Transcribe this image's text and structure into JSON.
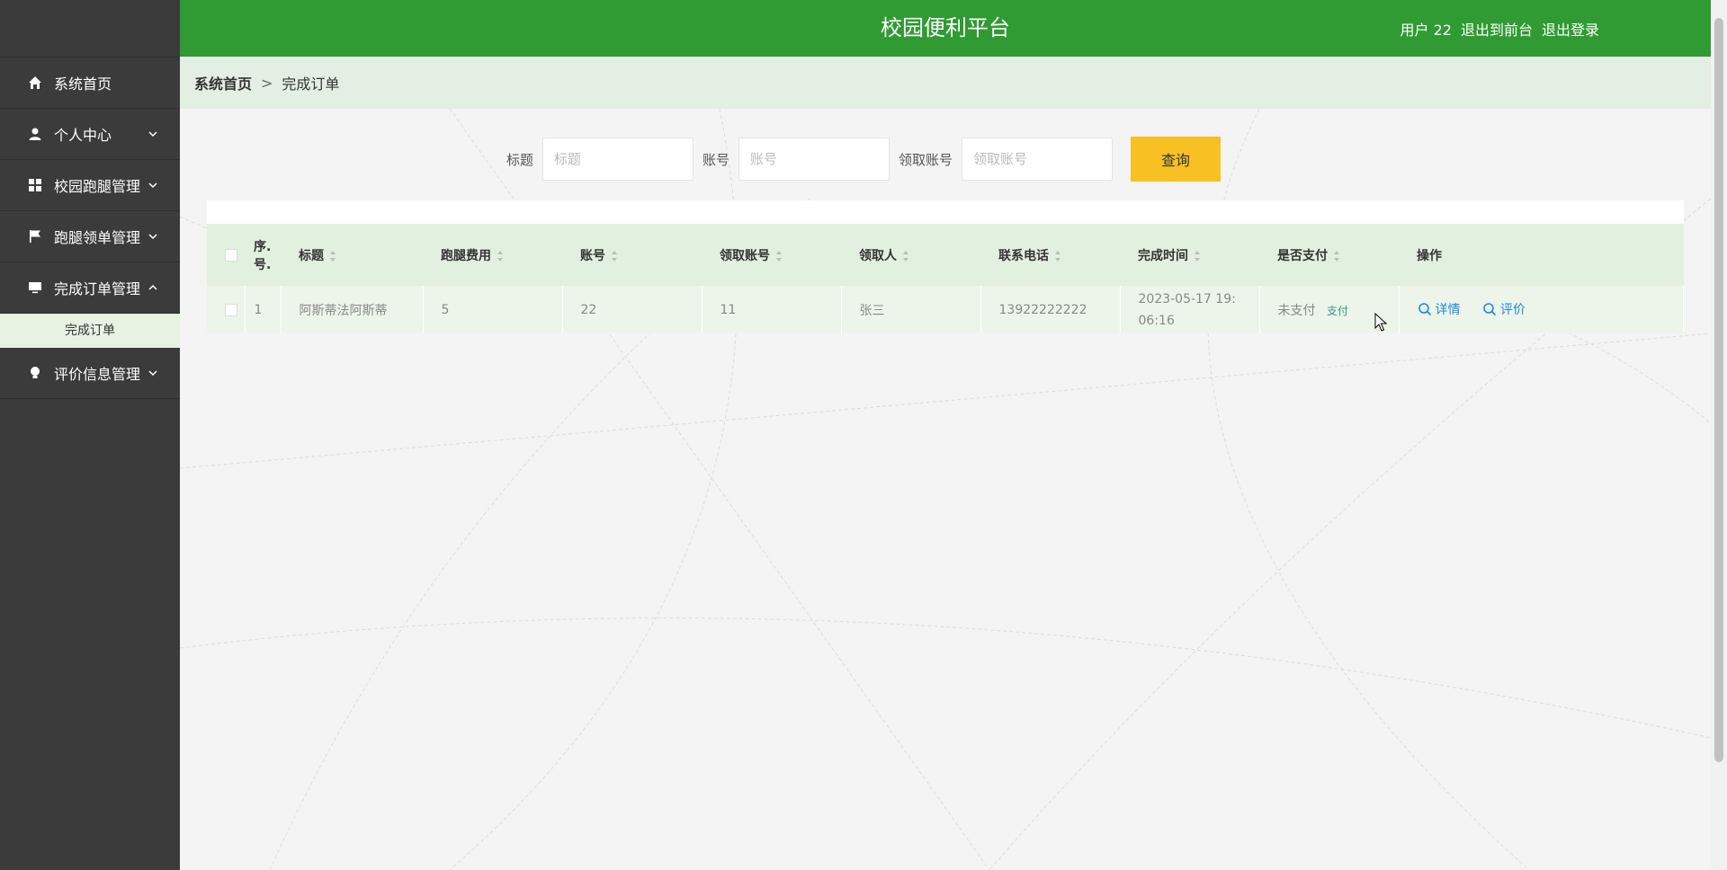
{
  "header": {
    "title": "校园便利平台",
    "user": "用户 22",
    "to_front": "退出到前台",
    "logout": "退出登录"
  },
  "sidebar": {
    "items": [
      {
        "label": "系统首页",
        "icon": "home-icon"
      },
      {
        "label": "个人中心",
        "icon": "user-icon"
      },
      {
        "label": "校园跑腿管理",
        "icon": "grid-icon"
      },
      {
        "label": "跑腿领单管理",
        "icon": "flag-icon"
      },
      {
        "label": "完成订单管理",
        "icon": "monitor-icon"
      },
      {
        "label": "评价信息管理",
        "icon": "bulb-icon"
      }
    ],
    "submenu": {
      "label": "完成订单"
    }
  },
  "breadcrumb": {
    "home": "系统首页",
    "sep": ">",
    "current": "完成订单"
  },
  "search": {
    "title_label": "标题",
    "title_placeholder": "标题",
    "account_label": "账号",
    "account_placeholder": "账号",
    "receiver_label": "领取账号",
    "receiver_placeholder": "领取账号",
    "button": "查询"
  },
  "table": {
    "headers": {
      "index": "序.号.",
      "title": "标题",
      "fee": "跑腿费用",
      "account": "账号",
      "receiver_account": "领取账号",
      "receiver": "领取人",
      "phone": "联系电话",
      "finish_time": "完成时间",
      "paid": "是否支付",
      "ops": "操作"
    },
    "rows": [
      {
        "index": "1",
        "title": "阿斯蒂法阿斯蒂",
        "fee": "5",
        "account": "22",
        "receiver_account": "11",
        "receiver": "张三",
        "phone": "13922222222",
        "finish_time": "2023-05-17 19:06:16",
        "paid": "未支付",
        "pay_action": "支付",
        "detail": "详情",
        "review": "评价"
      }
    ]
  }
}
